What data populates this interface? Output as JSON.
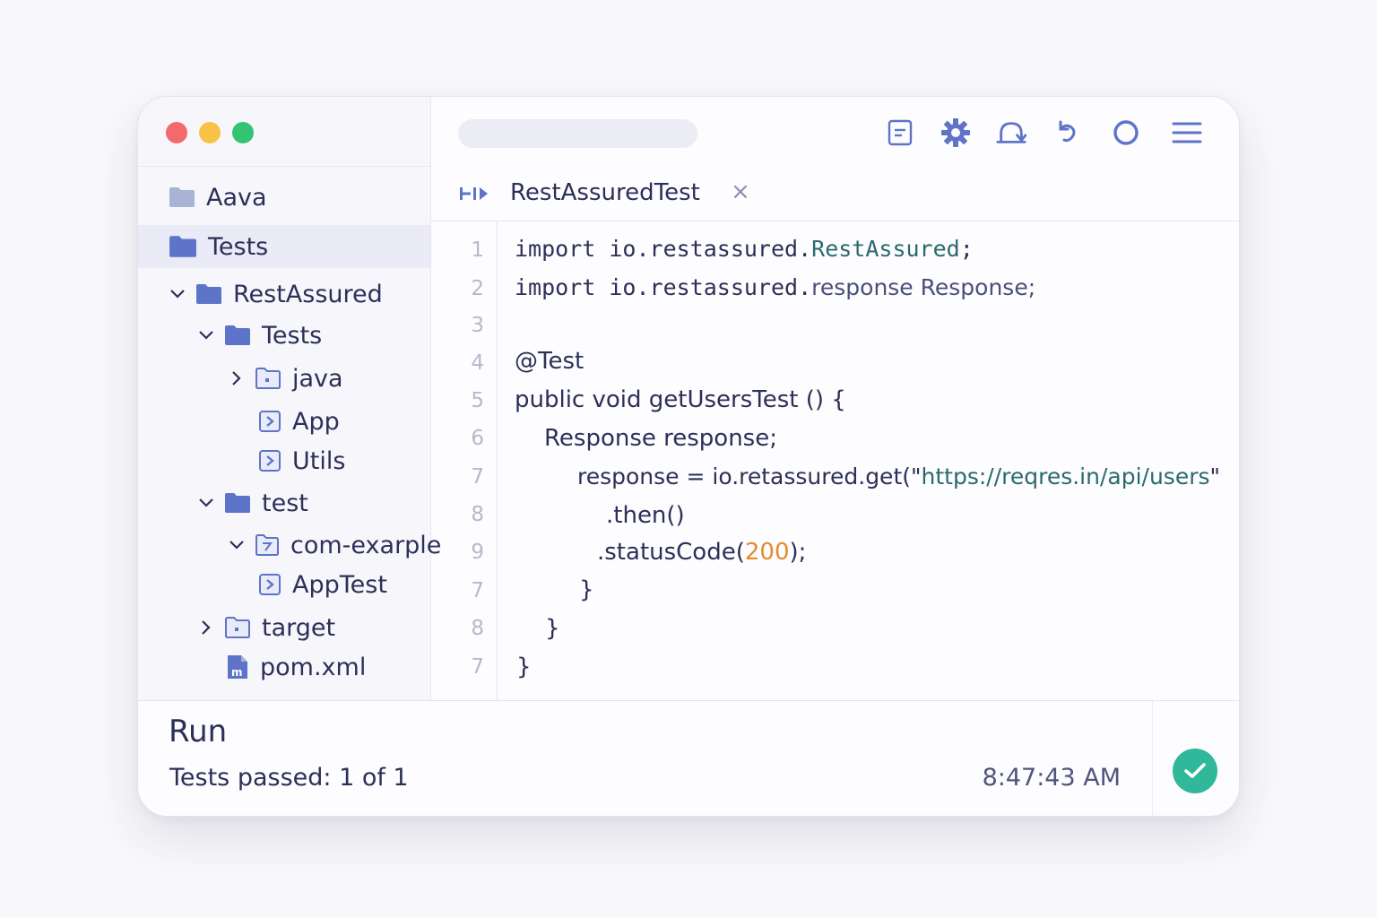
{
  "sidebar": {
    "items": [
      {
        "label": "Aava"
      },
      {
        "label": "Tests"
      },
      {
        "label": "RestAssured"
      },
      {
        "label": "Tests"
      },
      {
        "label": "java"
      },
      {
        "label": "App"
      },
      {
        "label": "Utils"
      },
      {
        "label": "test"
      },
      {
        "label": "com-exarple"
      },
      {
        "label": "AppTest"
      },
      {
        "label": "target"
      },
      {
        "label": "pom.xml"
      }
    ]
  },
  "toolbar": {
    "icons": [
      "document-icon",
      "gear-icon",
      "sync-icon",
      "undo-icon",
      "circle-icon",
      "menu-icon"
    ]
  },
  "editor": {
    "tab_title": "RestAssuredTest",
    "tab_close": "×",
    "line_numbers": [
      "1",
      "2",
      "3",
      "4",
      "5",
      "6",
      "7",
      "8",
      "9",
      "7",
      "8",
      "7"
    ],
    "lines": {
      "l1_a": "import io.restassured.",
      "l1_b": "RestAssured",
      "l1_c": ";",
      "l2_a": "import io.restassured.",
      "l2_b": "response Response;",
      "l4": "@Test",
      "l5": "public void getUsersTest () {",
      "l6": "Response response;",
      "l7_a": "response = io.retassured.get(\"",
      "l7_b": "https://reqres.in/api/users",
      "l7_c": "\"",
      "l8": ".then()",
      "l9_a": ".statusCode(",
      "l9_b": "200",
      "l9_c": ");",
      "l10": "}",
      "l11": "}",
      "l12": "}"
    }
  },
  "run": {
    "title": "Run",
    "status": "Tests passed: 1 of 1",
    "time": "8:47:43 AM"
  },
  "colors": {
    "accent": "#5d74c9",
    "success": "#2fb89a",
    "string": "#2a6a6e",
    "number": "#e68a2e"
  }
}
